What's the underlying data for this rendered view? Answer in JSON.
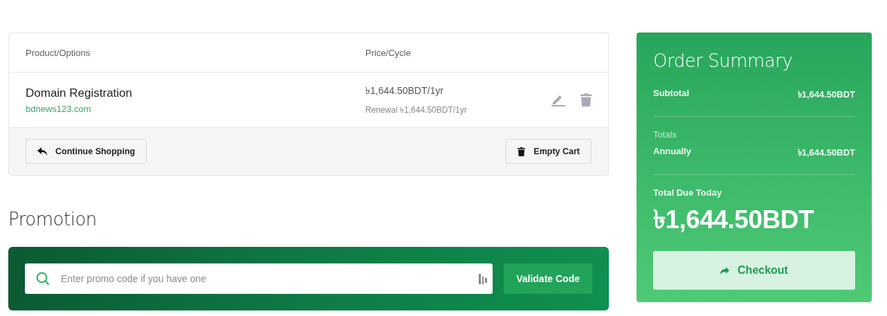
{
  "cart": {
    "columns": [
      "Product/Options",
      "Price/Cycle"
    ],
    "items": [
      {
        "name": "Domain Registration",
        "domain": "bdnews123.com",
        "price": "৳1,644.50BDT/1yr",
        "renewal": "Renewal ৳1,644.50BDT/1yr"
      }
    ],
    "buttons": [
      {
        "label": "Continue Shopping",
        "kind": "back"
      },
      {
        "label": "Empty Cart",
        "kind": "trash"
      }
    ]
  },
  "promotion": {
    "title": "Promotion",
    "placeholder": "Enter promo code if you have one",
    "button": "Validate Code"
  },
  "summary": {
    "title": "Order Summary",
    "subtotal": {
      "label": "Subtotal",
      "value": "৳1,644.50BDT"
    },
    "totals_heading": "Totals",
    "totals": [
      {
        "label": "Annually",
        "value": "৳1,644.50BDT"
      }
    ],
    "due_label": "Total Due Today",
    "due_value": "৳1,644.50BDT",
    "checkout": "Checkout"
  }
}
